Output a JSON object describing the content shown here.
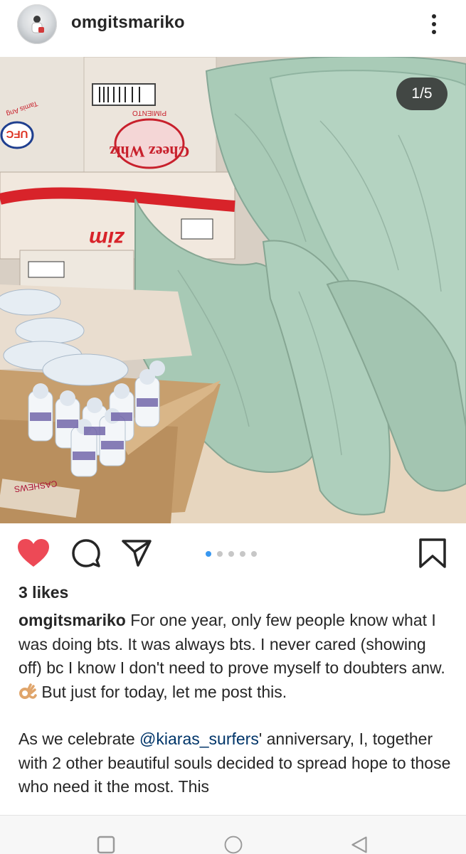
{
  "post": {
    "username": "omgitsmariko",
    "image_counter": "1/5",
    "carousel": {
      "total": 5,
      "active": 1
    },
    "likes": "3 likes",
    "caption": {
      "username": "omgitsmariko",
      "part1": "For one year, only few people know what I was doing bts. It was always bts. I never cared (showing off) bc I know I don't need to prove myself to doubters anw.",
      "part2": " But just for today, let me post this.",
      "p2_before": "As we celebrate ",
      "mention": "@kiaras_surfers",
      "p2_after": "' anniversary, I, together with 2 other beautiful souls decided to spread hope to those who need it the most. This"
    },
    "photo_labels": {
      "box_ufc": "UFC",
      "box_tamis": "Tamis Ang",
      "box_cheez": "Cheez Whiz",
      "box_cheez_sub": "PIMIENTO",
      "box_zim": "zim",
      "box_cashews": "CASHEWS"
    }
  },
  "icons": {
    "like": "heart-icon",
    "comment": "comment-icon",
    "share": "send-icon",
    "save": "bookmark-icon",
    "more": "more-vertical-icon",
    "nav_recents": "square-icon",
    "nav_home": "circle-icon",
    "nav_back": "triangle-back-icon"
  },
  "colors": {
    "like_red": "#ed4956",
    "active_dot": "#3897f0",
    "sack_green": "#a9cbb7",
    "mention_blue": "#003569"
  }
}
